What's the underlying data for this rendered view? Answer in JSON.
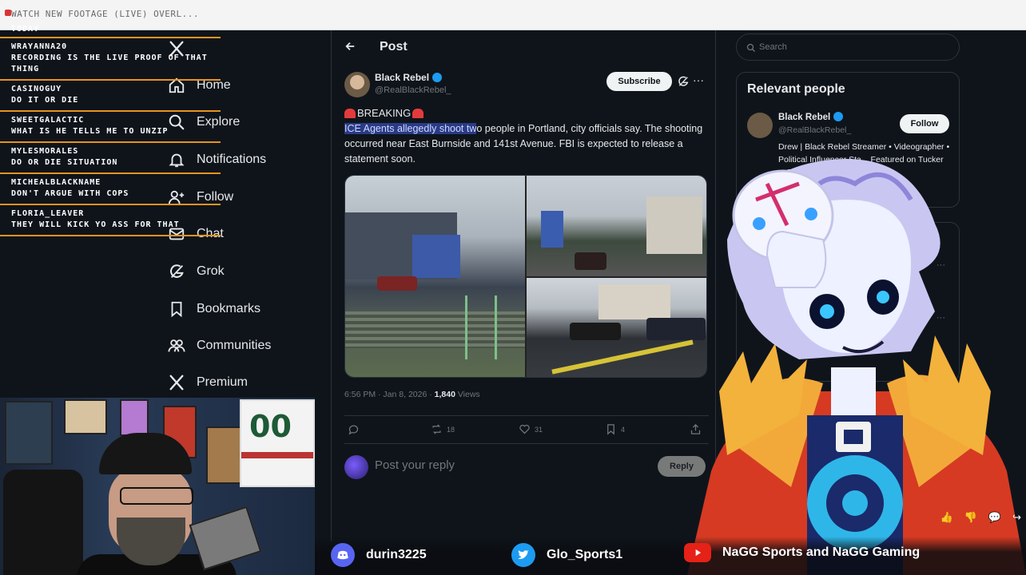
{
  "browser": {
    "tab_title": "WATCH NEW FOOTAGE (LIVE) OVERL..."
  },
  "chat": {
    "top_fragment": "TODAY",
    "messages": [
      {
        "user": "WRAYANNA20",
        "text": "RECORDING IS THE LIVE PROOF OF THAT THING"
      },
      {
        "user": "CASINOGUY",
        "text": "DO IT OR DIE"
      },
      {
        "user": "SWEETGALACTIC",
        "text": "WHAT IS HE TELLS ME TO UNZIP"
      },
      {
        "user": "MYLESMORALES",
        "text": "DO OR DIE SITUATION"
      },
      {
        "user": "MICHEALBLACKNAME",
        "text": "DON'T ARGUE WITH COPS"
      },
      {
        "user": "FLORIA_LEAVER",
        "text": "THEY WILL KICK YO ASS FOR THAT"
      }
    ]
  },
  "nav": {
    "items": [
      {
        "label": "Home",
        "icon": "home-icon"
      },
      {
        "label": "Explore",
        "icon": "search-icon"
      },
      {
        "label": "Notifications",
        "icon": "bell-icon"
      },
      {
        "label": "Follow",
        "icon": "add-user-icon"
      },
      {
        "label": "Chat",
        "icon": "mail-icon"
      },
      {
        "label": "Grok",
        "icon": "grok-icon"
      },
      {
        "label": "Bookmarks",
        "icon": "bookmark-icon"
      },
      {
        "label": "Communities",
        "icon": "people-icon"
      },
      {
        "label": "Premium",
        "icon": "x-logo-icon"
      }
    ]
  },
  "post": {
    "header_title": "Post",
    "author_name": "Black Rebel",
    "author_handle": "@RealBlackRebel_",
    "subscribe_label": "Subscribe",
    "breaking_label": "BREAKING",
    "text_highlight": "ICE Agents allegedly shoot tw",
    "text_rest_line1": "o people in Portland, city officials say. The",
    "text_rest": "shooting occurred near East Burnside and 141st Avenue. FBI is expected to release a statement soon.",
    "timestamp": "6:56 PM · Jan 8, 2026 · ",
    "views_count": "1,840",
    "views_label": " Views",
    "reposts": "18",
    "likes": "31",
    "bookmarks": "4",
    "reply_placeholder": "Post your reply",
    "reply_button": "Reply"
  },
  "sidebar": {
    "search_placeholder": "Search",
    "relevant_title": "Relevant people",
    "person_name": "Black Rebel",
    "person_handle": "@RealBlackRebel_",
    "follow_label": "Follow",
    "bio": "Drew | Black Rebel Streamer • Videographer • Political Influencer Sta... Featured on Tucker ... The Neighbor,"
  },
  "social": {
    "discord": "durin3225",
    "twitter": "Glo_Sports1",
    "youtube": "NaGG Sports and NaGG Gaming"
  },
  "colors": {
    "chat_divider": "#e6941d",
    "accent_blue": "#1d9bf0",
    "highlight": "#2a3b86"
  }
}
